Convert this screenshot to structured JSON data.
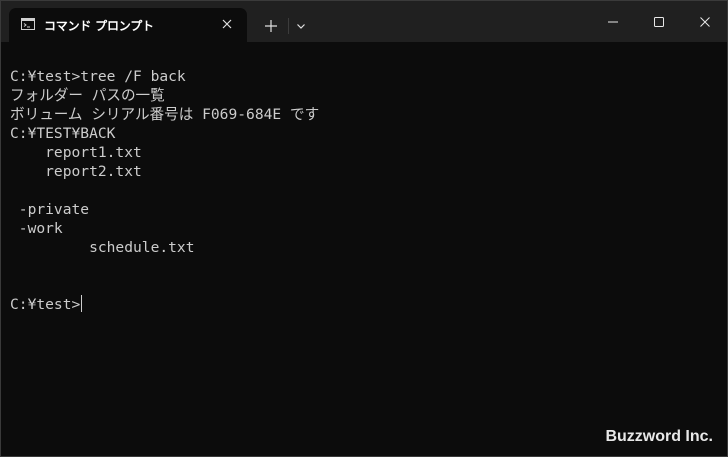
{
  "window": {
    "tab_title": "コマンド プロンプト",
    "tab_icon": "terminal-icon",
    "new_tab_icon": "plus-icon",
    "dropdown_icon": "chevron-down-icon",
    "controls": [
      "minimize-icon",
      "maximize-icon",
      "close-icon"
    ]
  },
  "console": {
    "lines": [
      "C:¥test>tree /F back",
      "フォルダー パスの一覧",
      "ボリューム シリアル番号は F069-684E です",
      "C:¥TEST¥BACK",
      "    report1.txt",
      "    report2.txt",
      "",
      " -private",
      " -work",
      "         schedule.txt",
      "",
      "",
      "C:¥test>"
    ]
  },
  "watermark": "Buzzword Inc.",
  "colors": {
    "background": "#0c0c0c",
    "titlebar": "#202020",
    "text": "#cccccc"
  }
}
